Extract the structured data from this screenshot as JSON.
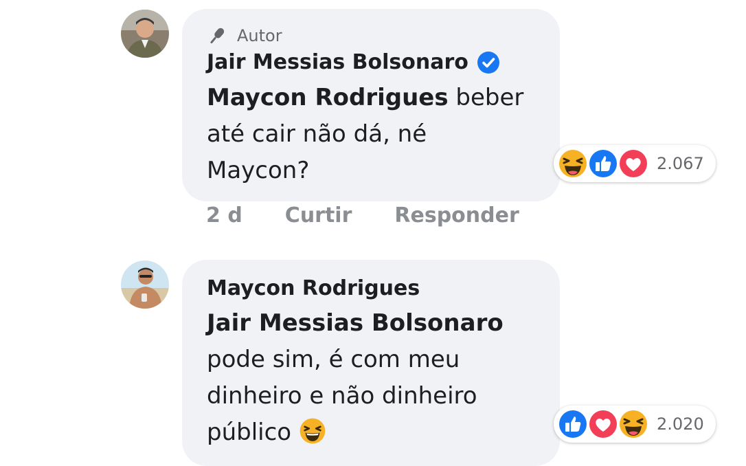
{
  "comments": [
    {
      "badge_label": "Autor",
      "author": "Jair Messias Bolsonaro",
      "verified": true,
      "mention": "Maycon Rodrigues",
      "text_line1_rest": " beber",
      "text_line2": "até cair não dá, né",
      "text_line3": "Maycon?",
      "reactions": [
        "haha-icon",
        "like-icon",
        "love-icon"
      ],
      "reaction_count": "2.067",
      "time": "2 d",
      "like_label": "Curtir",
      "reply_label": "Responder"
    },
    {
      "author": "Maycon Rodrigues",
      "mention": "Jair Messias Bolsonaro",
      "text_line2": "pode sim, é com meu",
      "text_line3": "dinheiro e não dinheiro",
      "text_line4": "público",
      "inline_emoji": "grinning-squinting-emoji",
      "reactions": [
        "like-icon",
        "love-icon",
        "haha-icon"
      ],
      "reaction_count": "2.020"
    }
  ],
  "colors": {
    "bubble": "#f0f2f5",
    "like": "#1877f2",
    "love": "#f33e58",
    "haha": "#f7b125",
    "muted": "#8a8d91"
  }
}
